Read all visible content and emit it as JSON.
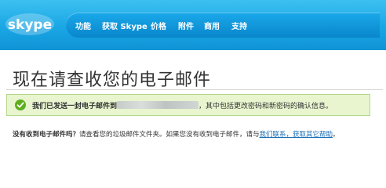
{
  "header": {
    "logo_text": "skype",
    "nav": [
      "功能",
      "获取 Skype",
      "价格",
      "附件",
      "商用",
      "支持"
    ]
  },
  "page_title": "现在请查收您的电子邮件",
  "notice": {
    "bold": "我们已发送一封电子邮件到",
    "rest": "，其中包括更改密码和新密码的确认信息。"
  },
  "help": {
    "question": "没有收到电子邮件吗？",
    "text": "请查看您的垃圾邮件文件夹。如果您没有收到电子邮件，请与",
    "link": "我们联系，获取其它帮助",
    "end": "。"
  },
  "colors": {
    "header_blue": "#1aa6e4",
    "notice_green": "#e8f5cf",
    "link_blue": "#1a6fb8"
  }
}
